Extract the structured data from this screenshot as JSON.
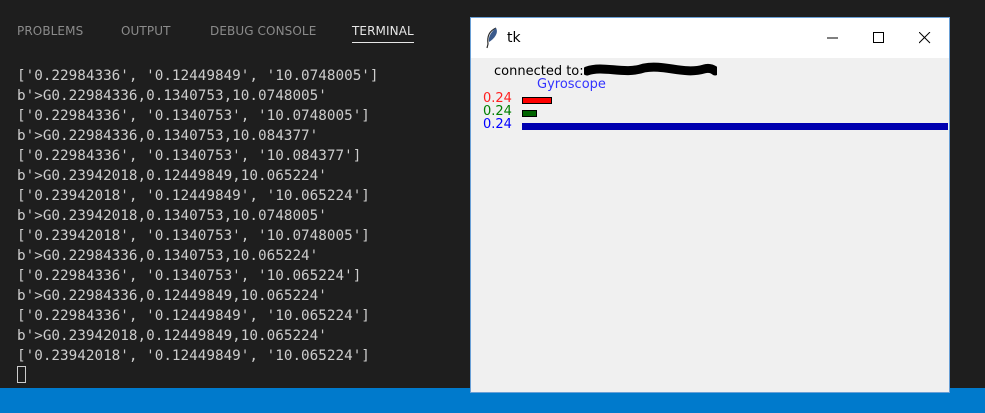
{
  "panel_tabs": [
    {
      "label": "PROBLEMS",
      "active": false
    },
    {
      "label": "OUTPUT",
      "active": false
    },
    {
      "label": "DEBUG CONSOLE",
      "active": false
    },
    {
      "label": "TERMINAL",
      "active": true
    }
  ],
  "terminal": {
    "lines": [
      "['0.22984336', '0.12449849', '10.0748005']",
      "b'>G0.22984336,0.1340753,10.0748005'",
      "['0.22984336', '0.1340753', '10.0748005']",
      "b'>G0.22984336,0.1340753,10.084377'",
      "['0.22984336', '0.1340753', '10.084377']",
      "b'>G0.23942018,0.12449849,10.065224'",
      "['0.23942018', '0.12449849', '10.065224']",
      "b'>G0.23942018,0.1340753,10.0748005'",
      "['0.23942018', '0.1340753', '10.0748005']",
      "b'>G0.22984336,0.1340753,10.065224'",
      "['0.22984336', '0.1340753', '10.065224']",
      "b'>G0.22984336,0.12449849,10.065224'",
      "['0.22984336', '0.12449849', '10.065224']",
      "b'>G0.23942018,0.12449849,10.065224'",
      "['0.23942018', '0.12449849', '10.065224']"
    ]
  },
  "tk_window": {
    "title": "tk",
    "connected_label": "connected to:",
    "sensor_label": "Gyroscope",
    "axes": [
      {
        "value": "0.24",
        "color": "#ff2020",
        "bar_color": "#ff0000",
        "level": 0.07
      },
      {
        "value": "0.24",
        "color": "#008000",
        "bar_color": "#006400",
        "level": 0.036
      },
      {
        "value": "0.24",
        "color": "#0000ff",
        "bar_color": "#0000b0",
        "level": 1.0
      }
    ]
  },
  "colors": {
    "panel_bg": "#1e1e1e",
    "statusbar": "#007acc",
    "terminal_text": "#cccccc"
  }
}
